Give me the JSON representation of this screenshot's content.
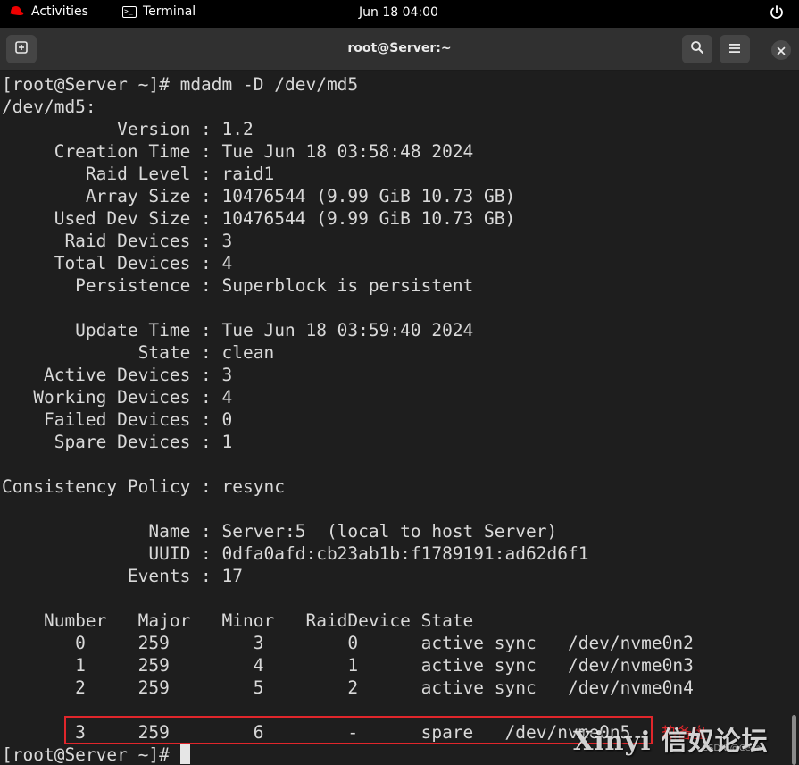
{
  "topbar": {
    "activities": "Activities",
    "app_name": "Terminal",
    "clock": "Jun 18  04:00"
  },
  "window": {
    "title": "root@Server:~"
  },
  "terminal": {
    "lines": [
      "[root@Server ~]# mdadm -D /dev/md5",
      "/dev/md5:",
      "           Version : 1.2",
      "     Creation Time : Tue Jun 18 03:58:48 2024",
      "        Raid Level : raid1",
      "        Array Size : 10476544 (9.99 GiB 10.73 GB)",
      "     Used Dev Size : 10476544 (9.99 GiB 10.73 GB)",
      "      Raid Devices : 3",
      "     Total Devices : 4",
      "       Persistence : Superblock is persistent",
      "",
      "       Update Time : Tue Jun 18 03:59:40 2024",
      "             State : clean",
      "    Active Devices : 3",
      "   Working Devices : 4",
      "    Failed Devices : 0",
      "     Spare Devices : 1",
      "",
      "Consistency Policy : resync",
      "",
      "              Name : Server:5  (local to host Server)",
      "              UUID : 0dfa0afd:cb23ab1b:f1789191:ad62d6f1",
      "            Events : 17",
      "",
      "    Number   Major   Minor   RaidDevice State",
      "       0     259        3        0      active sync   /dev/nvme0n2",
      "       1     259        4        1      active sync   /dev/nvme0n3",
      "       2     259        5        2      active sync   /dev/nvme0n4",
      "",
      "       3     259        6        -      spare   /dev/nvme0n5"
    ],
    "prompt": "[root@Server ~]# "
  },
  "annotation": {
    "label": "热备盘",
    "color": "#e0262b"
  },
  "watermark": {
    "text": "Xinyi 信奴论坛",
    "sub": "CSDN @Ceca"
  },
  "colors": {
    "terminal_bg": "#1e1e1e",
    "terminal_fg": "#d9d9d9",
    "headerbar_bg": "#303030"
  },
  "icons": {
    "activities": "redhat-icon",
    "app": "terminal-icon",
    "power": "power-icon",
    "new_tab": "new-tab-icon",
    "search": "search-icon",
    "menu": "hamburger-menu-icon",
    "close": "close-icon"
  }
}
